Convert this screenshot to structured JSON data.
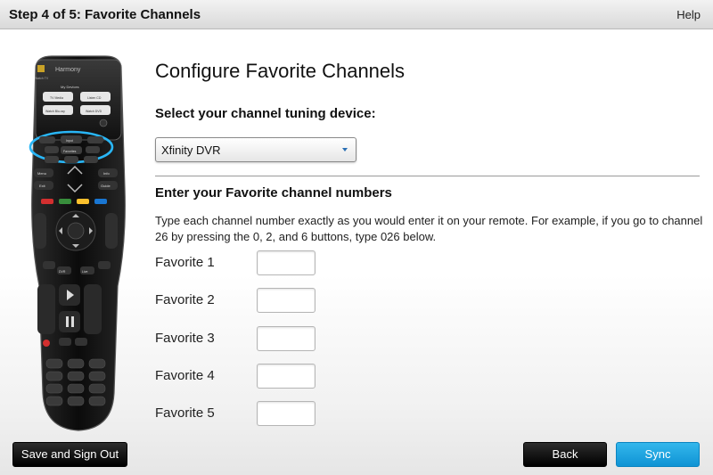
{
  "header": {
    "step_title": "Step 4 of 5: Favorite Channels",
    "help_label": "Help"
  },
  "remote": {
    "brand": "Harmony",
    "watch_tv": "Watch TV",
    "my_devices": "My Devices",
    "device_buttons": [
      "TV Media",
      "Listen CD",
      "Watch Blu-ray",
      "Watch DVD"
    ],
    "nav_labels": [
      "Input",
      "Favorites",
      "Menu",
      "Info",
      "Exit",
      "Guide"
    ],
    "playback_labels": [
      "DVR",
      "Live"
    ]
  },
  "main": {
    "title": "Configure Favorite Channels",
    "select_label": "Select your channel tuning device:",
    "device_select": {
      "value": "Xfinity DVR"
    },
    "favorites_heading": "Enter your Favorite channel numbers",
    "instructions": "Type each channel number exactly as you would enter it on your remote. For example, if you go to channel 26 by pressing the 0, 2, and 6 buttons, type 026 below.",
    "favorites": [
      {
        "label": "Favorite 1",
        "value": ""
      },
      {
        "label": "Favorite 2",
        "value": ""
      },
      {
        "label": "Favorite 3",
        "value": ""
      },
      {
        "label": "Favorite 4",
        "value": ""
      },
      {
        "label": "Favorite 5",
        "value": ""
      }
    ]
  },
  "footer": {
    "save_signout_label": "Save and Sign Out",
    "back_label": "Back",
    "sync_label": "Sync"
  },
  "colors": {
    "primary_blue": "#1ba3e0",
    "dark_button": "#111111",
    "highlight_ring": "#29b6f6"
  }
}
